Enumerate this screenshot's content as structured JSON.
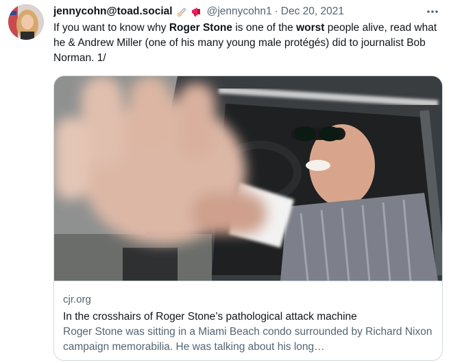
{
  "tweet": {
    "author_name": "jennycohn@toad.social",
    "author_emojis": [
      "writing-hand-icon",
      "megaphone-icon"
    ],
    "handle": "@jennycohn1",
    "separator": "·",
    "date": "Dec 20, 2021",
    "more_label": "•••",
    "text_parts": [
      "If you want to know why ",
      "Roger Stone",
      " is one of the ",
      "worst",
      " people alive, read what he & Andrew Miller (one of his many young male protégés) did to journalist Bob Norman. 1/"
    ]
  },
  "card": {
    "domain": "cjr.org",
    "title": "In the crosshairs of Roger Stone’s pathological attack machine",
    "description": "Roger Stone was sitting in a Miami Beach condo surrounded by Richard Nixon campaign memorabilia. He was talking about his long…"
  },
  "colors": {
    "text": "#0f1419",
    "secondary": "#536471",
    "border": "#cfd9de"
  }
}
